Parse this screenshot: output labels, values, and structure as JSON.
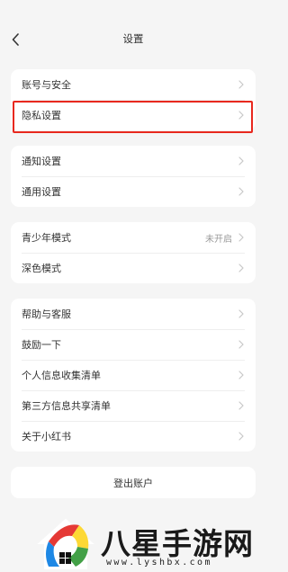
{
  "header": {
    "title": "设置",
    "back_icon": "chevron-left-icon"
  },
  "groups": [
    {
      "items": [
        {
          "label": "账号与安全"
        },
        {
          "label": "隐私设置",
          "highlighted": true
        }
      ]
    },
    {
      "items": [
        {
          "label": "通知设置"
        },
        {
          "label": "通用设置"
        }
      ]
    },
    {
      "items": [
        {
          "label": "青少年模式",
          "value": "未开启"
        },
        {
          "label": "深色模式"
        }
      ]
    },
    {
      "items": [
        {
          "label": "帮助与客服"
        },
        {
          "label": "鼓励一下"
        },
        {
          "label": "个人信息收集清单"
        },
        {
          "label": "第三方信息共享清单"
        },
        {
          "label": "关于小红书"
        }
      ]
    }
  ],
  "logout": {
    "label": "登出账户"
  },
  "watermark": {
    "brand": "八星手游网",
    "url": "www.lyshbx.com"
  },
  "colors": {
    "background": "#f5f5f5",
    "card": "#ffffff",
    "highlight": "#e8281e",
    "chevron": "#c8c8c8"
  }
}
